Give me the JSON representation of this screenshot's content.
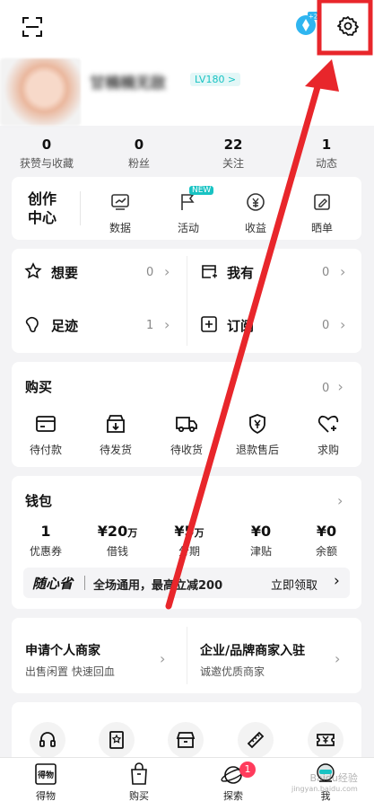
{
  "profile": {
    "name": "甘楠楠无敌",
    "level_badge": "LV180 >"
  },
  "counts": [
    {
      "value": "0",
      "label": "获赞与收藏"
    },
    {
      "value": "0",
      "label": "粉丝"
    },
    {
      "value": "22",
      "label": "关注"
    },
    {
      "value": "1",
      "label": "动态"
    }
  ],
  "creator": {
    "title_line1": "创作",
    "title_line2": "中心",
    "items": [
      {
        "label": "数据"
      },
      {
        "label": "活动",
        "badge": "NEW"
      },
      {
        "label": "收益"
      },
      {
        "label": "晒单"
      }
    ]
  },
  "collections": [
    {
      "label": "想要",
      "count": "0"
    },
    {
      "label": "我有",
      "count": "0"
    },
    {
      "label": "足迹",
      "count": "1"
    },
    {
      "label": "订阅",
      "count": "0"
    }
  ],
  "purchase": {
    "title": "购买",
    "count": "0",
    "items": [
      {
        "label": "待付款"
      },
      {
        "label": "待发货"
      },
      {
        "label": "待收货"
      },
      {
        "label": "退款售后"
      },
      {
        "label": "求购"
      }
    ]
  },
  "wallet": {
    "title": "钱包",
    "items": [
      {
        "value": "1",
        "unit": "",
        "label": "优惠券"
      },
      {
        "value": "¥20",
        "unit": "万",
        "label": "借钱"
      },
      {
        "value": "¥5",
        "unit": "万",
        "label": "分期"
      },
      {
        "value": "¥0",
        "unit": "",
        "label": "津贴"
      },
      {
        "value": "¥0",
        "unit": "",
        "label": "余额"
      }
    ],
    "promo": {
      "brand": "随心省",
      "text": "全场通用，最高立减200",
      "cta": "立即领取"
    }
  },
  "merchant": {
    "left_title": "申请个人商家",
    "left_sub": "出售闲置 快速回血",
    "right_title": "企业/品牌商家入驻",
    "right_sub": "诚邀优质商家"
  },
  "tabs": [
    {
      "label": "得物"
    },
    {
      "label": "购买"
    },
    {
      "label": "探索",
      "badge": "1"
    },
    {
      "label": "我"
    }
  ],
  "watermark": {
    "line1": "Baidu经验",
    "line2": "jingyan.baidu.com"
  },
  "colors": {
    "accent": "#18c3c3",
    "annotation": "#e8262b"
  }
}
